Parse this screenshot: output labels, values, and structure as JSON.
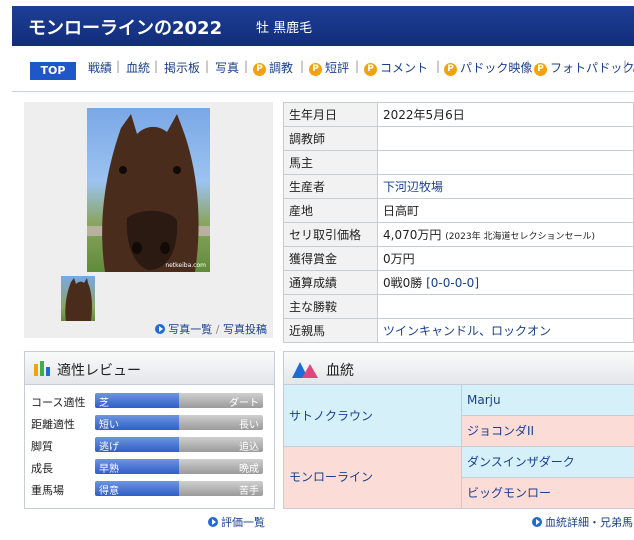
{
  "header": {
    "title": "モンローラインの2022",
    "subtitle": "牡 黒鹿毛"
  },
  "nav": {
    "top": "TOP",
    "items": [
      "戦績",
      "血統",
      "掲示板",
      "写真",
      "調教",
      "短評",
      "コメント",
      "パドック映像",
      "フォトパドック",
      "あ"
    ],
    "premium_icon": "P"
  },
  "photo": {
    "list_link": "写真一覧",
    "separator": "/",
    "post_link": "写真投稿",
    "watermark": "netkeiba.com"
  },
  "info": {
    "rows": [
      {
        "label": "生年月日",
        "value": "2022年5月6日"
      },
      {
        "label": "調教師",
        "value": ""
      },
      {
        "label": "馬主",
        "value": ""
      },
      {
        "label": "生産者",
        "value": "下河辺牧場"
      },
      {
        "label": "産地",
        "value": "日高町"
      },
      {
        "label": "セリ取引価格",
        "value": "4,070万円",
        "note": "(2023年 北海道セレクションセール)"
      },
      {
        "label": "獲得賞金",
        "value": "0万円"
      },
      {
        "label": "通算成績",
        "value": "0戦0勝",
        "link": "[0-0-0-0]"
      },
      {
        "label": "主な勝鞍",
        "value": ""
      },
      {
        "label": "近親馬",
        "value": "ツインキャンドル、ロックオン"
      }
    ]
  },
  "aptitude": {
    "title": "適性レビュー",
    "rows": [
      {
        "label": "コース適性",
        "left": "芝",
        "right": "ダート",
        "level": 0.5
      },
      {
        "label": "距離適性",
        "left": "短い",
        "right": "長い",
        "level": 0.5
      },
      {
        "label": "脚質",
        "left": "逃げ",
        "right": "追込",
        "level": 0.5
      },
      {
        "label": "成長",
        "left": "早熟",
        "right": "晩成",
        "level": 0.5
      },
      {
        "label": "重馬場",
        "left": "得意",
        "right": "苦手",
        "level": 0.5
      }
    ],
    "more_link": "評価一覧"
  },
  "pedigree": {
    "title": "血統",
    "sire": "サトノクラウン",
    "sire_sire": "Marju",
    "sire_dam": "ジョコンダII",
    "dam": "モンローライン",
    "dam_sire": "ダンスインザダーク",
    "dam_dam": "ビッグモンロー",
    "more_link": "血統詳細・兄弟馬"
  }
}
